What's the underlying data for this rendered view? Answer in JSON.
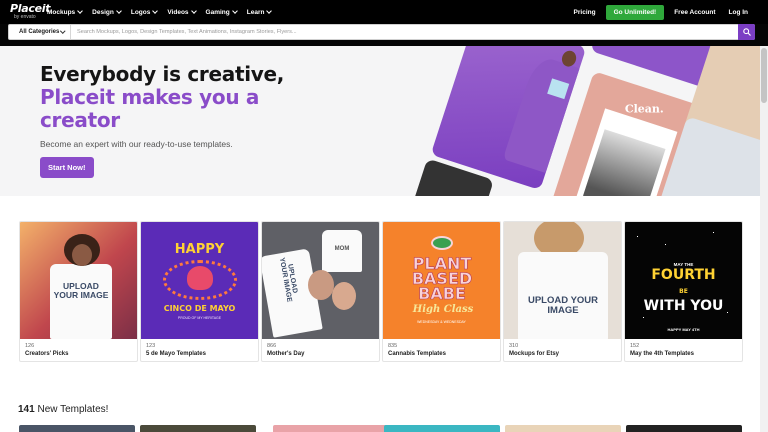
{
  "brand": {
    "name": "Placeit",
    "byline": "by envato"
  },
  "nav": {
    "menu": [
      "Mockups",
      "Design",
      "Logos",
      "Videos",
      "Gaming",
      "Learn"
    ],
    "pricing": "Pricing",
    "cta": "Go Unlimited!",
    "free_account": "Free Account",
    "login": "Log In"
  },
  "search": {
    "category": "All Categories",
    "placeholder": "Search Mockups, Logos, Design Templates, Text Animations, Instagram Stories, Flyers...",
    "button_icon": "search-icon"
  },
  "hero": {
    "title_line1": "Everybody is creative,",
    "title_line2": "Placeit makes you a creator",
    "subtitle": "Become an expert with our ready-to-use templates.",
    "button": "Start Now!",
    "art_texts": {
      "clean": "Clean."
    }
  },
  "categories": [
    {
      "count": "126",
      "title": "Creators' Picks",
      "shirt_text": "UPLOAD YOUR IMAGE"
    },
    {
      "count": "123",
      "title": "5 de Mayo Templates",
      "happy": "HAPPY",
      "name": "CINCO DE MAYO",
      "proud": "PROUD OF MY HERITAGE"
    },
    {
      "count": "866",
      "title": "Mother's Day",
      "shirt_text": "UPLOAD YOUR IMAGE",
      "mom": "MOM"
    },
    {
      "count": "835",
      "title": "Cannabis Templates",
      "plant": "PLANT BASED BABE",
      "high": "High Class",
      "strain": "WEDNESDAY & WEDNESDAY"
    },
    {
      "count": "310",
      "title": "Mockups for Etsy",
      "shirt_text": "UPLOAD YOUR IMAGE"
    },
    {
      "count": "152",
      "title": "May the 4th Templates",
      "may": "MAY THE",
      "big1": "FOURTH",
      "be": "BE",
      "big2": "WITH YOU",
      "foot": "HAPPY MAY 4TH"
    }
  ],
  "new_templates": {
    "count": "141",
    "label": "New Templates!"
  },
  "colors": {
    "accent_purple": "#8a4cc9",
    "cta_green": "#2fa83b",
    "nav_bg": "#000000"
  }
}
